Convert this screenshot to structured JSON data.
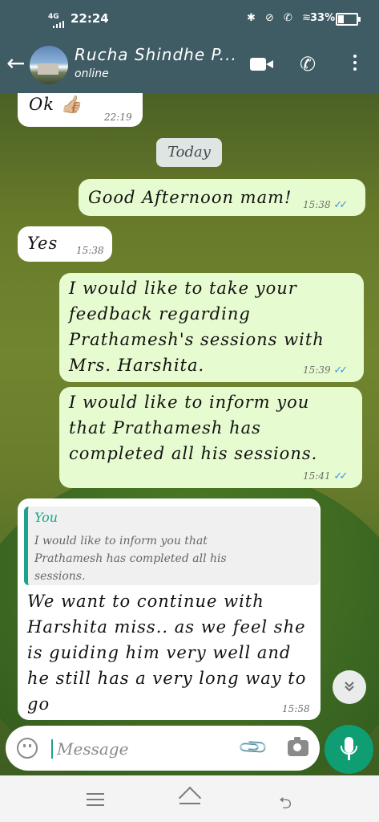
{
  "status_bar": {
    "network": "4G",
    "time": "22:24",
    "icons": "✱ ⊘ ✆ ≋",
    "battery": "33%"
  },
  "header": {
    "back_icon": "arrow-left-icon",
    "contact_name": "Rucha Shindhe P...",
    "status": "online",
    "actions": [
      "video-call-icon",
      "phone-icon",
      "more-vert-icon"
    ]
  },
  "chat": {
    "date_divider": "Today",
    "messages": [
      {
        "direction": "in",
        "text": "Ok 👍🏼",
        "time": "22:19"
      },
      {
        "direction": "out",
        "text": "Good Afternoon mam!",
        "time": "15:38",
        "ticks": "✓✓"
      },
      {
        "direction": "in",
        "text": "Yes",
        "time": "15:38"
      },
      {
        "direction": "out",
        "lines": [
          "I would like to take your",
          "feedback regarding",
          "Prathamesh's sessions with",
          "Mrs. Harshita."
        ],
        "time": "15:39",
        "ticks": "✓✓"
      },
      {
        "direction": "out",
        "lines": [
          "I would like to inform you",
          "that Prathamesh has",
          "completed all his sessions."
        ],
        "time": "15:41",
        "ticks": "✓✓"
      },
      {
        "direction": "in",
        "reply_to": {
          "author": "You",
          "lines": [
            "I would like to inform you that",
            "Prathamesh has completed all his",
            "sessions."
          ]
        },
        "lines": [
          "We want to continue with",
          "Harshita miss.. as we feel she",
          "is guiding him very well and",
          "he still has a very long way to",
          "go"
        ],
        "time": "15:58"
      }
    ],
    "scroll_down_icon": "double-chevron-down-icon"
  },
  "composer": {
    "placeholder": "Message",
    "value": ""
  },
  "nav_bar": {
    "back_glyph": "⮌"
  },
  "colors": {
    "header_bg": "#3f5b63",
    "outgoing_bubble": "#e6fbcf",
    "incoming_bubble": "#ffffff",
    "read_ticks": "#3a94ea",
    "accent": "#0f9d74"
  }
}
